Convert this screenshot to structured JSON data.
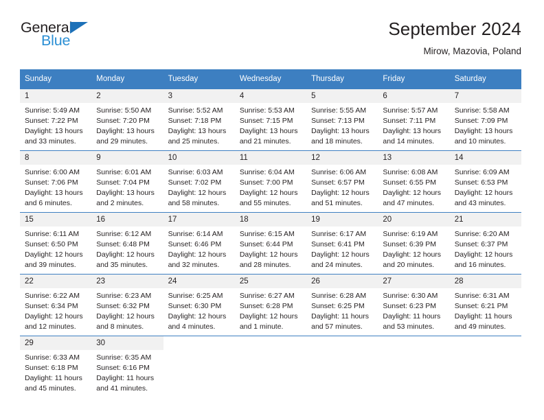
{
  "brand": {
    "name_dark": "General",
    "name_blue": "Blue",
    "accent_blue": "#2b8fd4",
    "triangle_blue": "#1d71b8"
  },
  "header": {
    "title": "September 2024",
    "subtitle": "Mirow, Mazovia, Poland",
    "header_bg": "#3d7fc1",
    "header_text_color": "#ffffff"
  },
  "weekdays": [
    "Sunday",
    "Monday",
    "Tuesday",
    "Wednesday",
    "Thursday",
    "Friday",
    "Saturday"
  ],
  "labels": {
    "sunrise_prefix": "Sunrise:",
    "sunset_prefix": "Sunset:",
    "daylight_prefix": "Daylight:"
  },
  "weeks": [
    [
      {
        "day": "1",
        "sunrise": "Sunrise: 5:49 AM",
        "sunset": "Sunset: 7:22 PM",
        "daylight1": "Daylight: 13 hours",
        "daylight2": "and 33 minutes."
      },
      {
        "day": "2",
        "sunrise": "Sunrise: 5:50 AM",
        "sunset": "Sunset: 7:20 PM",
        "daylight1": "Daylight: 13 hours",
        "daylight2": "and 29 minutes."
      },
      {
        "day": "3",
        "sunrise": "Sunrise: 5:52 AM",
        "sunset": "Sunset: 7:18 PM",
        "daylight1": "Daylight: 13 hours",
        "daylight2": "and 25 minutes."
      },
      {
        "day": "4",
        "sunrise": "Sunrise: 5:53 AM",
        "sunset": "Sunset: 7:15 PM",
        "daylight1": "Daylight: 13 hours",
        "daylight2": "and 21 minutes."
      },
      {
        "day": "5",
        "sunrise": "Sunrise: 5:55 AM",
        "sunset": "Sunset: 7:13 PM",
        "daylight1": "Daylight: 13 hours",
        "daylight2": "and 18 minutes."
      },
      {
        "day": "6",
        "sunrise": "Sunrise: 5:57 AM",
        "sunset": "Sunset: 7:11 PM",
        "daylight1": "Daylight: 13 hours",
        "daylight2": "and 14 minutes."
      },
      {
        "day": "7",
        "sunrise": "Sunrise: 5:58 AM",
        "sunset": "Sunset: 7:09 PM",
        "daylight1": "Daylight: 13 hours",
        "daylight2": "and 10 minutes."
      }
    ],
    [
      {
        "day": "8",
        "sunrise": "Sunrise: 6:00 AM",
        "sunset": "Sunset: 7:06 PM",
        "daylight1": "Daylight: 13 hours",
        "daylight2": "and 6 minutes."
      },
      {
        "day": "9",
        "sunrise": "Sunrise: 6:01 AM",
        "sunset": "Sunset: 7:04 PM",
        "daylight1": "Daylight: 13 hours",
        "daylight2": "and 2 minutes."
      },
      {
        "day": "10",
        "sunrise": "Sunrise: 6:03 AM",
        "sunset": "Sunset: 7:02 PM",
        "daylight1": "Daylight: 12 hours",
        "daylight2": "and 58 minutes."
      },
      {
        "day": "11",
        "sunrise": "Sunrise: 6:04 AM",
        "sunset": "Sunset: 7:00 PM",
        "daylight1": "Daylight: 12 hours",
        "daylight2": "and 55 minutes."
      },
      {
        "day": "12",
        "sunrise": "Sunrise: 6:06 AM",
        "sunset": "Sunset: 6:57 PM",
        "daylight1": "Daylight: 12 hours",
        "daylight2": "and 51 minutes."
      },
      {
        "day": "13",
        "sunrise": "Sunrise: 6:08 AM",
        "sunset": "Sunset: 6:55 PM",
        "daylight1": "Daylight: 12 hours",
        "daylight2": "and 47 minutes."
      },
      {
        "day": "14",
        "sunrise": "Sunrise: 6:09 AM",
        "sunset": "Sunset: 6:53 PM",
        "daylight1": "Daylight: 12 hours",
        "daylight2": "and 43 minutes."
      }
    ],
    [
      {
        "day": "15",
        "sunrise": "Sunrise: 6:11 AM",
        "sunset": "Sunset: 6:50 PM",
        "daylight1": "Daylight: 12 hours",
        "daylight2": "and 39 minutes."
      },
      {
        "day": "16",
        "sunrise": "Sunrise: 6:12 AM",
        "sunset": "Sunset: 6:48 PM",
        "daylight1": "Daylight: 12 hours",
        "daylight2": "and 35 minutes."
      },
      {
        "day": "17",
        "sunrise": "Sunrise: 6:14 AM",
        "sunset": "Sunset: 6:46 PM",
        "daylight1": "Daylight: 12 hours",
        "daylight2": "and 32 minutes."
      },
      {
        "day": "18",
        "sunrise": "Sunrise: 6:15 AM",
        "sunset": "Sunset: 6:44 PM",
        "daylight1": "Daylight: 12 hours",
        "daylight2": "and 28 minutes."
      },
      {
        "day": "19",
        "sunrise": "Sunrise: 6:17 AM",
        "sunset": "Sunset: 6:41 PM",
        "daylight1": "Daylight: 12 hours",
        "daylight2": "and 24 minutes."
      },
      {
        "day": "20",
        "sunrise": "Sunrise: 6:19 AM",
        "sunset": "Sunset: 6:39 PM",
        "daylight1": "Daylight: 12 hours",
        "daylight2": "and 20 minutes."
      },
      {
        "day": "21",
        "sunrise": "Sunrise: 6:20 AM",
        "sunset": "Sunset: 6:37 PM",
        "daylight1": "Daylight: 12 hours",
        "daylight2": "and 16 minutes."
      }
    ],
    [
      {
        "day": "22",
        "sunrise": "Sunrise: 6:22 AM",
        "sunset": "Sunset: 6:34 PM",
        "daylight1": "Daylight: 12 hours",
        "daylight2": "and 12 minutes."
      },
      {
        "day": "23",
        "sunrise": "Sunrise: 6:23 AM",
        "sunset": "Sunset: 6:32 PM",
        "daylight1": "Daylight: 12 hours",
        "daylight2": "and 8 minutes."
      },
      {
        "day": "24",
        "sunrise": "Sunrise: 6:25 AM",
        "sunset": "Sunset: 6:30 PM",
        "daylight1": "Daylight: 12 hours",
        "daylight2": "and 4 minutes."
      },
      {
        "day": "25",
        "sunrise": "Sunrise: 6:27 AM",
        "sunset": "Sunset: 6:28 PM",
        "daylight1": "Daylight: 12 hours",
        "daylight2": "and 1 minute."
      },
      {
        "day": "26",
        "sunrise": "Sunrise: 6:28 AM",
        "sunset": "Sunset: 6:25 PM",
        "daylight1": "Daylight: 11 hours",
        "daylight2": "and 57 minutes."
      },
      {
        "day": "27",
        "sunrise": "Sunrise: 6:30 AM",
        "sunset": "Sunset: 6:23 PM",
        "daylight1": "Daylight: 11 hours",
        "daylight2": "and 53 minutes."
      },
      {
        "day": "28",
        "sunrise": "Sunrise: 6:31 AM",
        "sunset": "Sunset: 6:21 PM",
        "daylight1": "Daylight: 11 hours",
        "daylight2": "and 49 minutes."
      }
    ],
    [
      {
        "day": "29",
        "sunrise": "Sunrise: 6:33 AM",
        "sunset": "Sunset: 6:18 PM",
        "daylight1": "Daylight: 11 hours",
        "daylight2": "and 45 minutes."
      },
      {
        "day": "30",
        "sunrise": "Sunrise: 6:35 AM",
        "sunset": "Sunset: 6:16 PM",
        "daylight1": "Daylight: 11 hours",
        "daylight2": "and 41 minutes."
      },
      {
        "day": "",
        "sunrise": "",
        "sunset": "",
        "daylight1": "",
        "daylight2": ""
      },
      {
        "day": "",
        "sunrise": "",
        "sunset": "",
        "daylight1": "",
        "daylight2": ""
      },
      {
        "day": "",
        "sunrise": "",
        "sunset": "",
        "daylight1": "",
        "daylight2": ""
      },
      {
        "day": "",
        "sunrise": "",
        "sunset": "",
        "daylight1": "",
        "daylight2": ""
      },
      {
        "day": "",
        "sunrise": "",
        "sunset": "",
        "daylight1": "",
        "daylight2": ""
      }
    ]
  ]
}
